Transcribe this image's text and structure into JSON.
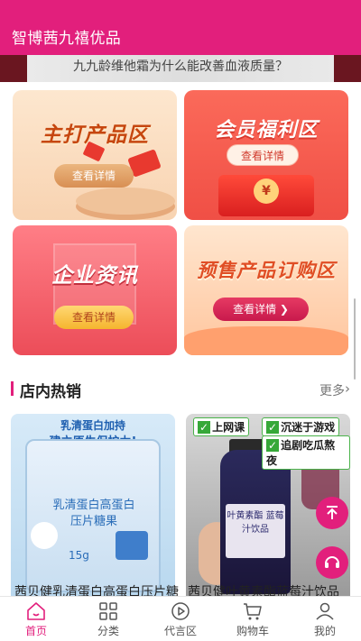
{
  "app": {
    "title": "智博茜九禧优品"
  },
  "banner": {
    "text": "九九龄维他霜为什么能改善血液质量？"
  },
  "cards": [
    {
      "title": "主打产品区",
      "button": "查看详情"
    },
    {
      "title": "会员福利区",
      "button": "查看详情"
    },
    {
      "title": "企业资讯",
      "button": "查看详情"
    },
    {
      "title": "预售产品订购区",
      "button": "查看详情 ❯"
    }
  ],
  "section": {
    "title": "店内热销",
    "more": "更多"
  },
  "products": [
    {
      "tag_line1": "乳清蛋白加持",
      "tag_line2": "建立原生保护力!",
      "name_line1": "乳清蛋白高蛋白",
      "name_line2": "压片糖果",
      "weight": "15g",
      "title": "茜贝健乳清蛋白高蛋白压片糖果"
    },
    {
      "badges": [
        "上网课",
        "沉迷于游戏",
        "追剧吃瓜熬夜"
      ],
      "label": "叶黄素酯\n蓝莓汁饮品",
      "title": "茜贝健叶黄素酯蓝莓汁饮品"
    }
  ],
  "tabs": [
    {
      "label": "首页",
      "icon": "home-icon",
      "active": true
    },
    {
      "label": "分类",
      "icon": "grid-icon",
      "active": false
    },
    {
      "label": "代言区",
      "icon": "play-icon",
      "active": false
    },
    {
      "label": "购物车",
      "icon": "cart-icon",
      "active": false
    },
    {
      "label": "我的",
      "icon": "user-icon",
      "active": false
    }
  ],
  "colors": {
    "brand": "#e21f7c"
  }
}
